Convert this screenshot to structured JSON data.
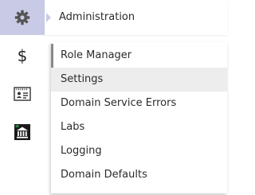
{
  "nav": {
    "items": [
      {
        "name": "gear",
        "active": true
      },
      {
        "name": "dollar",
        "active": false
      },
      {
        "name": "id-card",
        "active": false
      },
      {
        "name": "institution",
        "active": false
      }
    ],
    "dollar_glyph": "$"
  },
  "popout": {
    "title": "Administration",
    "menu": [
      {
        "label": "Role Manager"
      },
      {
        "label": "Settings"
      },
      {
        "label": "Domain Service Errors"
      },
      {
        "label": "Labs"
      },
      {
        "label": "Logging"
      },
      {
        "label": "Domain Defaults"
      }
    ]
  },
  "colors": {
    "active_nav_bg": "#c9cbe6",
    "icon": "#333333",
    "hover_bg": "#ededed",
    "indicator": "#8a8a8a"
  }
}
